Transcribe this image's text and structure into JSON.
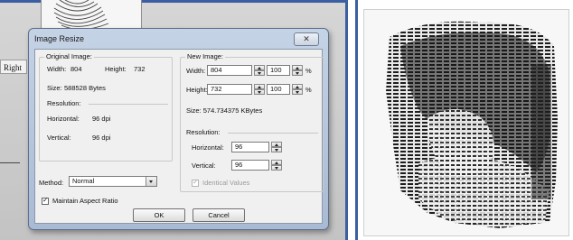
{
  "left_window": {
    "side_label": "Right"
  },
  "dialog": {
    "title": "Image Resize",
    "close_label": "✕",
    "original_image": {
      "group_title": "Original Image:",
      "width_label": "Width:",
      "width_value": "804",
      "height_label": "Height:",
      "height_value": "732",
      "size_label": "Size:",
      "size_value": "588528 Bytes"
    },
    "original_resolution": {
      "title": "Resolution:",
      "horizontal_label": "Horizontal:",
      "horizontal_value": "96 dpi",
      "vertical_label": "Vertical:",
      "vertical_value": "96 dpi"
    },
    "new_image": {
      "group_title": "New Image:",
      "width_label": "Width:",
      "width_value": "804",
      "width_percent": "100",
      "height_label": "Height:",
      "height_value": "732",
      "height_percent": "100",
      "percent_sign": "%",
      "size_text": "Size: 574.734375 KBytes"
    },
    "new_resolution": {
      "title": "Resolution:",
      "horizontal_label": "Horizontal:",
      "horizontal_value": "96",
      "vertical_label": "Vertical:",
      "vertical_value": "96",
      "identical_label": "Identical Values",
      "identical_checked": true
    },
    "method": {
      "label": "Method:",
      "selected": "Normal"
    },
    "maintain_aspect": {
      "label": "Maintain Aspect Ratio",
      "checked": true
    },
    "ok_label": "OK",
    "cancel_label": "Cancel"
  },
  "colors": {
    "window_border": "#3b5fa0",
    "dialog_frame": "#b8c7dd",
    "dialog_body": "#f0f0f0"
  }
}
